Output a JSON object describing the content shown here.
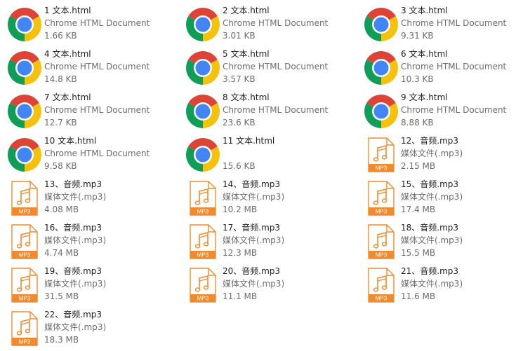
{
  "files": [
    {
      "name": "1 文本.html",
      "type": "Chrome HTML Document",
      "size": "1.66 KB",
      "icon": "chrome-icon"
    },
    {
      "name": "2 文本.html",
      "type": "Chrome HTML Document",
      "size": "3.01 KB",
      "icon": "chrome-icon"
    },
    {
      "name": "3 文本.html",
      "type": "Chrome HTML Document",
      "size": "9.31 KB",
      "icon": "chrome-icon"
    },
    {
      "name": "4 文本.html",
      "type": "Chrome HTML Document",
      "size": "14.8 KB",
      "icon": "chrome-icon"
    },
    {
      "name": "5 文本.html",
      "type": "Chrome HTML Document",
      "size": "3.57 KB",
      "icon": "chrome-icon"
    },
    {
      "name": "6 文本.html",
      "type": "Chrome HTML Document",
      "size": "10.3 KB",
      "icon": "chrome-icon"
    },
    {
      "name": "7 文本.html",
      "type": "Chrome HTML Document",
      "size": "12.7 KB",
      "icon": "chrome-icon"
    },
    {
      "name": "8 文本.html",
      "type": "Chrome HTML Document",
      "size": "23.6 KB",
      "icon": "chrome-icon"
    },
    {
      "name": "9 文本.html",
      "type": "Chrome HTML Document",
      "size": "8.88 KB",
      "icon": "chrome-icon"
    },
    {
      "name": "10 文本.html",
      "type": "Chrome HTML Document",
      "size": "9.58 KB",
      "icon": "chrome-icon"
    },
    {
      "name": "11 文本.html",
      "type": "",
      "size": "15.6 KB",
      "icon": "chrome-icon"
    },
    {
      "name": "12、音频.mp3",
      "type": "媒体文件(.mp3)",
      "size": "2.15 MB",
      "icon": "mp3-file-icon"
    },
    {
      "name": "13、音频.mp3",
      "type": "媒体文件(.mp3)",
      "size": "4.08 MB",
      "icon": "mp3-file-icon"
    },
    {
      "name": "14、音频.mp3",
      "type": "媒体文件(.mp3)",
      "size": "10.2 MB",
      "icon": "mp3-file-icon"
    },
    {
      "name": "15、音频.mp3",
      "type": "媒体文件(.mp3)",
      "size": "17.4 MB",
      "icon": "mp3-file-icon"
    },
    {
      "name": "16、音频.mp3",
      "type": "媒体文件(.mp3)",
      "size": "4.74 MB",
      "icon": "mp3-file-icon"
    },
    {
      "name": "17、音频.mp3",
      "type": "媒体文件(.mp3)",
      "size": "12.3 MB",
      "icon": "mp3-file-icon"
    },
    {
      "name": "18、音频.mp3",
      "type": "媒体文件(.mp3)",
      "size": "15.5 MB",
      "icon": "mp3-file-icon"
    },
    {
      "name": "19、音频.mp3",
      "type": "媒体文件(.mp3)",
      "size": "31.5 MB",
      "icon": "mp3-file-icon"
    },
    {
      "name": "20、音频.mp3",
      "type": "媒体文件(.mp3)",
      "size": "11.1 MB",
      "icon": "mp3-file-icon"
    },
    {
      "name": "21、音频.mp3",
      "type": "媒体文件(.mp3)",
      "size": "11.6 MB",
      "icon": "mp3-file-icon"
    },
    {
      "name": "22、音频.mp3",
      "type": "媒体文件(.mp3)",
      "size": "18.3 MB",
      "icon": "mp3-file-icon"
    }
  ],
  "mp3_badge": "MP3",
  "colors": {
    "chrome_red": "#DB4437",
    "chrome_yellow": "#F4C20D",
    "chrome_green": "#0F9D58",
    "chrome_blue": "#4285F4",
    "mp3_orange": "#F08A2E"
  }
}
